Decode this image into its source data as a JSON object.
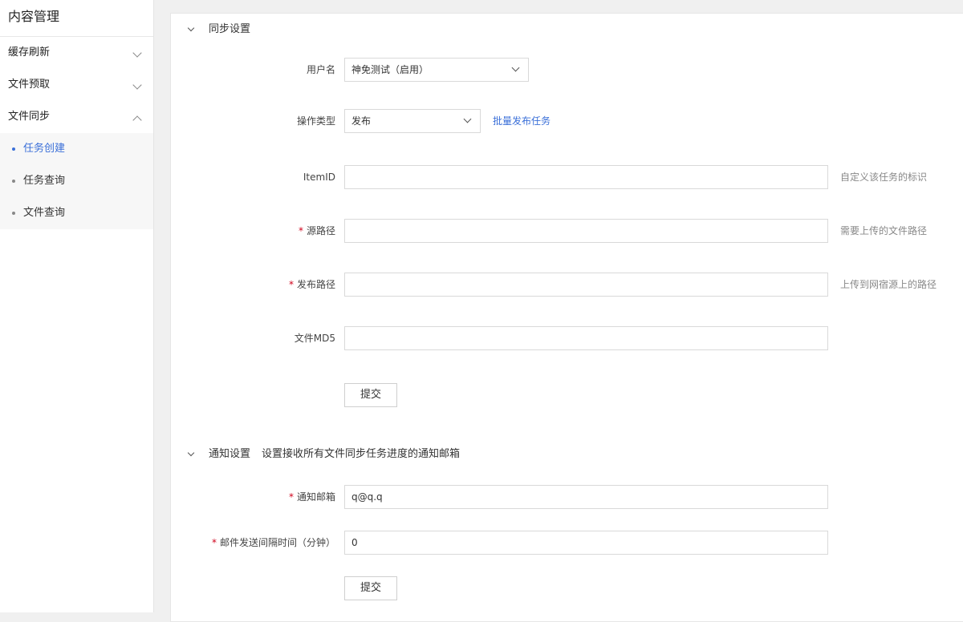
{
  "sidebar": {
    "title": "内容管理",
    "groups": [
      {
        "label": "缓存刷新"
      },
      {
        "label": "文件预取"
      },
      {
        "label": "文件同步"
      }
    ],
    "items": [
      {
        "label": "任务创建"
      },
      {
        "label": "任务查询"
      },
      {
        "label": "文件查询"
      }
    ]
  },
  "sync": {
    "title": "同步设置",
    "username": {
      "label": "用户名",
      "value": "神免测试（启用）"
    },
    "op_type": {
      "label": "操作类型",
      "value": "发布",
      "link": "批量发布任务"
    },
    "item_id": {
      "label": "ItemID",
      "value": "",
      "hint": "自定义该任务的标识"
    },
    "source_path": {
      "label": "源路径",
      "value": "",
      "hint": "需要上传的文件路径"
    },
    "publish_path": {
      "label": "发布路径",
      "value": "",
      "hint": "上传到网宿源上的路径"
    },
    "md5": {
      "label": "文件MD5",
      "value": ""
    },
    "submit": "提交"
  },
  "notify": {
    "title": "通知设置",
    "desc": "设置接收所有文件同步任务进度的通知邮箱",
    "email": {
      "label": "通知邮箱",
      "value": "q@q.q"
    },
    "interval": {
      "label": "邮件发送间隔时间（分钟）",
      "value": "0"
    },
    "submit": "提交"
  },
  "required_mark": "*",
  "colors": {
    "accent": "#3a6fd8",
    "required": "#d0021b"
  }
}
